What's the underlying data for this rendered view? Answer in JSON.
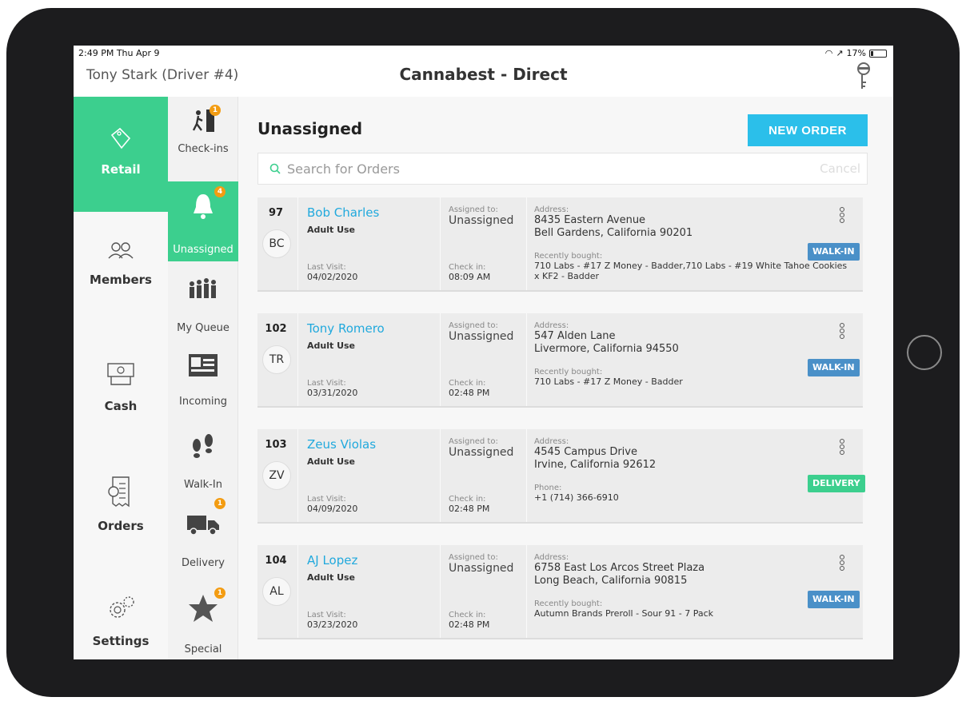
{
  "status": {
    "time": "2:49 PM  Thu Apr 9",
    "battery": "17%"
  },
  "header": {
    "driver": "Tony Stark (Driver #4)",
    "title": "Cannabest - Direct"
  },
  "nav_primary": [
    {
      "label": "Retail",
      "icon": "tags-icon",
      "active": true
    },
    {
      "label": "Members",
      "icon": "members-icon"
    },
    {
      "label": "Cash",
      "icon": "cash-icon"
    },
    {
      "label": "Orders",
      "icon": "orders-icon"
    },
    {
      "label": "Settings",
      "icon": "gears-icon"
    }
  ],
  "nav_secondary": [
    {
      "label": "Check-ins",
      "badge": "1"
    },
    {
      "label": "Unassigned",
      "badge": "4",
      "active": true
    },
    {
      "label": "My Queue"
    },
    {
      "label": "Incoming"
    },
    {
      "label": "Walk-In"
    },
    {
      "label": "Delivery",
      "badge": "1"
    },
    {
      "label": "Special",
      "badge": "1"
    }
  ],
  "main": {
    "heading": "Unassigned",
    "new_order": "NEW ORDER",
    "search_placeholder": "Search for Orders",
    "cancel": "Cancel"
  },
  "labels": {
    "assigned_to": "Assigned to:",
    "address": "Address:",
    "last_visit": "Last Visit:",
    "check_in": "Check in:",
    "recently_bought": "Recently bought:",
    "phone": "Phone:"
  },
  "orders": [
    {
      "number": "97",
      "initials": "BC",
      "name": "Bob Charles",
      "use": "Adult Use",
      "assigned": "Unassigned",
      "address1": "8435 Eastern Avenue",
      "address2": "Bell Gardens, California 90201",
      "last_visit": "04/02/2020",
      "check_in": "08:09 AM",
      "extra_label": "Recently bought:",
      "extra_value": "710 Labs - #17 Z Money - Badder,710 Labs - #19 White Tahoe Cookies x KF2 - Badder",
      "tag": "WALK-IN",
      "tag_color": "#4a90c8"
    },
    {
      "number": "102",
      "initials": "TR",
      "name": "Tony Romero",
      "use": "Adult Use",
      "assigned": "Unassigned",
      "address1": "547 Alden Lane",
      "address2": "Livermore, California 94550",
      "last_visit": "03/31/2020",
      "check_in": "02:48 PM",
      "extra_label": "Recently bought:",
      "extra_value": "710 Labs - #17 Z Money - Badder",
      "tag": "WALK-IN",
      "tag_color": "#4a90c8"
    },
    {
      "number": "103",
      "initials": "ZV",
      "name": "Zeus Violas",
      "use": "Adult Use",
      "assigned": "Unassigned",
      "address1": "4545 Campus Drive",
      "address2": "Irvine, California 92612",
      "last_visit": "04/09/2020",
      "check_in": "02:48 PM",
      "extra_label": "Phone:",
      "extra_value": "+1 (714) 366-6910",
      "tag": "DELIVERY",
      "tag_color": "#3ccf8e"
    },
    {
      "number": "104",
      "initials": "AL",
      "name": "AJ Lopez",
      "use": "Adult Use",
      "assigned": "Unassigned",
      "address1": "6758 East Los Arcos Street Plaza",
      "address2": "Long Beach, California 90815",
      "last_visit": "03/23/2020",
      "check_in": "02:48 PM",
      "extra_label": "Recently bought:",
      "extra_value": "Autumn Brands Preroll - Sour 91 - 7 Pack",
      "tag": "WALK-IN",
      "tag_color": "#4a90c8"
    }
  ]
}
